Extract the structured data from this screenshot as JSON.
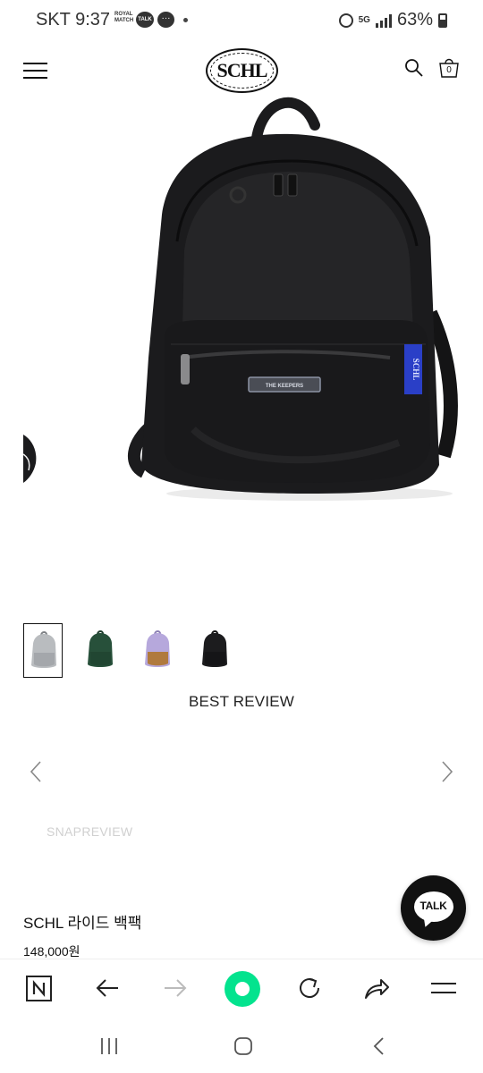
{
  "status_bar": {
    "time": "SKT 9:37",
    "notif_royal": "ROYAL MATCH",
    "notif_talk": "TALK",
    "network": "5G",
    "battery": "63%"
  },
  "header": {
    "logo": "SCHL",
    "cart_count": "0"
  },
  "product": {
    "patch_text": "THE KEEPERS",
    "side_tag": "SCHL",
    "name": "SCHL 라이드 백팩",
    "price": "148,000원",
    "thumbnails": [
      {
        "color": "#b9bcbf",
        "selected": true
      },
      {
        "color": "#27503a",
        "selected": false
      },
      {
        "color": "#b6a8dc",
        "bottom": "#b07a3e",
        "selected": false
      },
      {
        "color": "#1c1c1e",
        "selected": false
      }
    ]
  },
  "review": {
    "heading": "BEST REVIEW",
    "snap_label": "SNAPREVIEW"
  },
  "talk_button": {
    "label": "TALK"
  },
  "colors": {
    "accent_green": "#03e38e",
    "bag_black": "#1b1b1d",
    "side_tag_blue": "#2a3fc7"
  }
}
